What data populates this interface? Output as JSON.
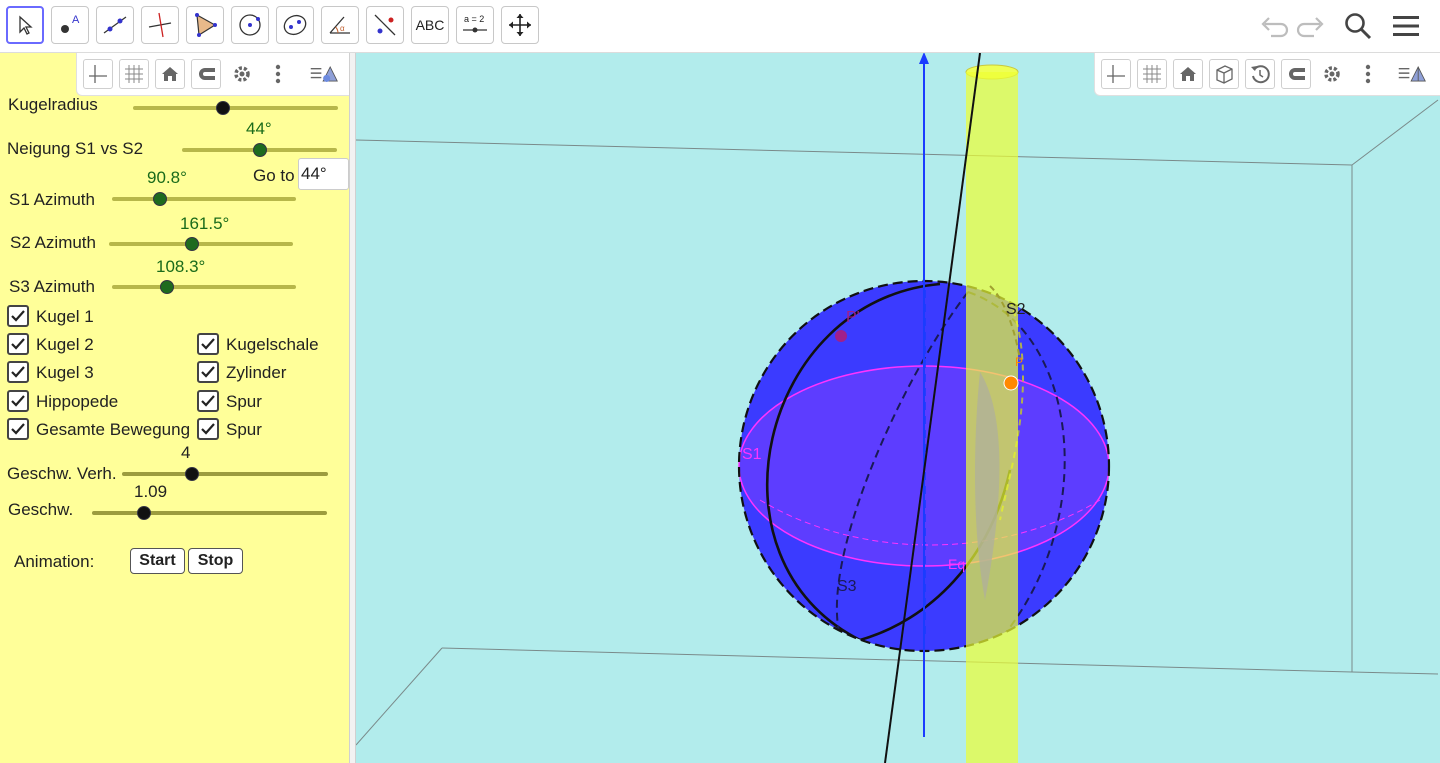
{
  "toolbar": {
    "tools": [
      {
        "name": "move-tool",
        "icon": "pointer-icon"
      },
      {
        "name": "point-tool",
        "icon": "point-icon",
        "label": "A"
      },
      {
        "name": "line-tool",
        "icon": "line-icon"
      },
      {
        "name": "perpendicular-tool",
        "icon": "perpendicular-icon"
      },
      {
        "name": "polygon-tool",
        "icon": "polygon-icon"
      },
      {
        "name": "circle-tool",
        "icon": "circle-icon"
      },
      {
        "name": "conic-tool",
        "icon": "ellipse-icon"
      },
      {
        "name": "angle-tool",
        "icon": "angle-icon",
        "label": "α"
      },
      {
        "name": "reflect-tool",
        "icon": "reflect-icon"
      },
      {
        "name": "text-tool",
        "icon": "text-icon",
        "label": "ABC"
      },
      {
        "name": "slider-tool",
        "icon": "slider-icon",
        "label": "a = 2"
      },
      {
        "name": "move-view-tool",
        "icon": "move-graphics-icon"
      }
    ],
    "undo_icon": "undo-icon",
    "redo_icon": "redo-icon",
    "search_icon": "search-icon",
    "menu_icon": "menu-icon"
  },
  "left_panel": {
    "bar_icons": [
      "axes-icon",
      "grid-icon",
      "home-icon",
      "magnet-icon",
      "gear-icon",
      "more-icon",
      "style-bar-icon"
    ],
    "kugelradius": {
      "label": "Kugelradius",
      "fraction": 0.44
    },
    "neigung": {
      "label": "Neigung S1 vs S2",
      "value": "44°",
      "fraction": 0.5
    },
    "goto": {
      "label": "Go to",
      "input_value": "44°"
    },
    "s1": {
      "label": "S1 Azimuth",
      "value": "90.8°",
      "fraction": 0.26
    },
    "s2": {
      "label": "S2 Azimuth",
      "value": "161.5°",
      "fraction": 0.45
    },
    "s3": {
      "label": "S3 Azimuth",
      "value": "108.3°",
      "fraction": 0.3
    },
    "checkboxes_left": [
      {
        "label": "Kugel 1",
        "checked": true
      },
      {
        "label": "Kugel 2",
        "checked": true
      },
      {
        "label": "Kugel 3",
        "checked": true
      },
      {
        "label": "Hippopede",
        "checked": true
      },
      {
        "label": "Gesamte Bewegung",
        "checked": true
      }
    ],
    "checkboxes_right": [
      {
        "label": "Kugelschale",
        "checked": true
      },
      {
        "label": "Zylinder",
        "checked": true
      },
      {
        "label": "Spur",
        "checked": true
      },
      {
        "label": "Spur",
        "checked": true
      }
    ],
    "geschw_verh": {
      "label": "Geschw. Verh.",
      "value": "4",
      "fraction": 0.34
    },
    "geschw": {
      "label": "Geschw.",
      "value": "1.09",
      "fraction": 0.22
    },
    "animation": {
      "label": "Animation:",
      "start": "Start",
      "stop": "Stop"
    }
  },
  "view3d": {
    "bar_icons": [
      "axes-icon",
      "grid-icon",
      "home-icon",
      "cube-icon",
      "rotate-icon",
      "magnet-icon",
      "gear-icon",
      "more-icon",
      "style-bar-icon"
    ],
    "labels": {
      "p_prime": "P'",
      "s1": "S1",
      "s2": "S2",
      "s3": "S3",
      "eq": "Eq",
      "p": "P"
    },
    "colors": {
      "background": "#b2ecec",
      "sphere": "#3b3bff",
      "equator": "#ff33ff",
      "cylinder": "#eeff33",
      "axis": "#1a3cff",
      "point": "#ff8800"
    }
  }
}
